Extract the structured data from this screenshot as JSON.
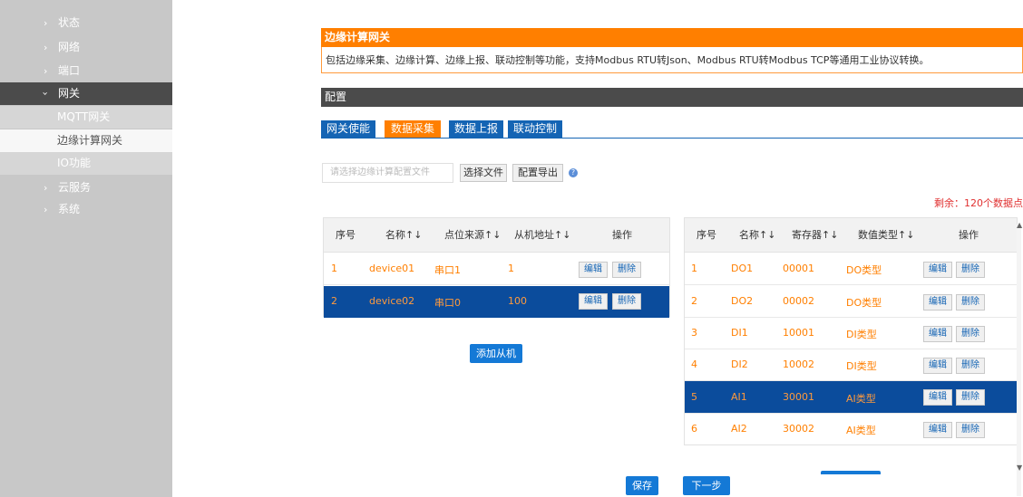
{
  "sidebar": {
    "items": [
      {
        "label": "状态"
      },
      {
        "label": "网络"
      },
      {
        "label": "端口"
      },
      {
        "label": "网关"
      },
      {
        "label": "云服务"
      },
      {
        "label": "系统"
      }
    ],
    "sub_items": [
      {
        "label": "MQTT网关"
      },
      {
        "label": "边缘计算网关"
      },
      {
        "label": "IO功能"
      }
    ]
  },
  "header": {
    "title": "边缘计算网关",
    "description": "包括边缘采集、边缘计算、边缘上报、联动控制等功能，支持Modbus RTU转Json、Modbus RTU转Modbus TCP等通用工业协议转换。"
  },
  "config": {
    "title": "配置"
  },
  "tabs": [
    {
      "label": "网关使能"
    },
    {
      "label": "数据采集"
    },
    {
      "label": "数据上报"
    },
    {
      "label": "联动控制"
    }
  ],
  "file": {
    "placeholder": "请选择边缘计算配置文件",
    "choose_label": "选择文件",
    "export_label": "配置导出"
  },
  "remaining": "剩余：120个数据点",
  "slave_table": {
    "headers": [
      "序号",
      "名称↑↓",
      "点位来源↑↓",
      "从机地址↑↓",
      "操作"
    ],
    "rows": [
      {
        "no": "1",
        "name": "device01",
        "source": "串口1",
        "addr": "1",
        "edit": "编辑",
        "del": "删除"
      },
      {
        "no": "2",
        "name": "device02",
        "source": "串口0",
        "addr": "100",
        "edit": "编辑",
        "del": "删除"
      }
    ],
    "add_label": "添加从机"
  },
  "point_table": {
    "headers": [
      "序号",
      "名称↑↓",
      "寄存器↑↓",
      "数值类型↑↓",
      "操作"
    ],
    "rows": [
      {
        "no": "1",
        "name": "DO1",
        "reg": "00001",
        "type": "DO类型",
        "edit": "编辑",
        "del": "删除"
      },
      {
        "no": "2",
        "name": "DO2",
        "reg": "00002",
        "type": "DO类型",
        "edit": "编辑",
        "del": "删除"
      },
      {
        "no": "3",
        "name": "DI1",
        "reg": "10001",
        "type": "DI类型",
        "edit": "编辑",
        "del": "删除"
      },
      {
        "no": "4",
        "name": "DI2",
        "reg": "10002",
        "type": "DI类型",
        "edit": "编辑",
        "del": "删除"
      },
      {
        "no": "5",
        "name": "AI1",
        "reg": "30001",
        "type": "AI类型",
        "edit": "编辑",
        "del": "删除"
      },
      {
        "no": "6",
        "name": "AI2",
        "reg": "30002",
        "type": "AI类型",
        "edit": "编辑",
        "del": "删除"
      }
    ]
  },
  "footer": {
    "save_label": "保存",
    "next_label": "下一步"
  },
  "colors": {
    "accent": "#ff7f00",
    "primary": "#1464b4",
    "selected_row": "#0b4c9c",
    "sidebar": "#c8c8c8"
  },
  "icons": {
    "chevron": "chevron-right-icon",
    "help": "help-icon"
  }
}
